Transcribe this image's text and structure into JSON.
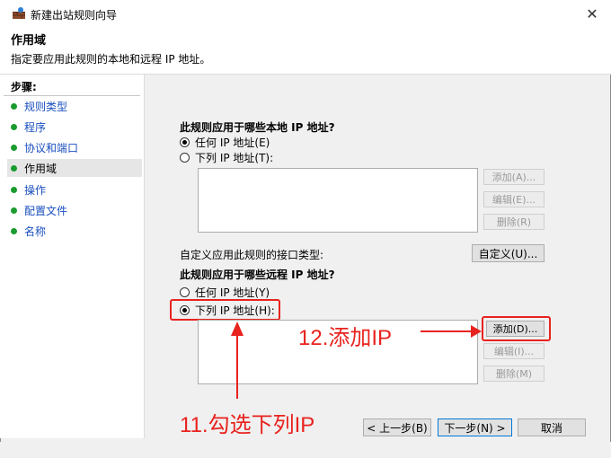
{
  "window": {
    "title": "新建出站规则向导",
    "close_glyph": "✕",
    "icon": "firewall-icon"
  },
  "header": {
    "title": "作用域",
    "description": "指定要应用此规则的本地和远程 IP 地址。"
  },
  "steps": {
    "heading": "步骤:",
    "items": [
      {
        "label": "规则类型",
        "active": false
      },
      {
        "label": "程序",
        "active": false
      },
      {
        "label": "协议和端口",
        "active": false
      },
      {
        "label": "作用域",
        "active": true
      },
      {
        "label": "操作",
        "active": false
      },
      {
        "label": "配置文件",
        "active": false
      },
      {
        "label": "名称",
        "active": false
      }
    ]
  },
  "local": {
    "question": "此规则应用于哪些本地 IP 地址?",
    "option_any": "任何 IP 地址(E)",
    "option_list": "下列 IP 地址(T):",
    "selected": "any",
    "add": "添加(A)...",
    "edit": "编辑(E)...",
    "remove": "删除(R)"
  },
  "interface": {
    "label": "自定义应用此规则的接口类型:",
    "button": "自定义(U)..."
  },
  "remote": {
    "question": "此规则应用于哪些远程 IP 地址?",
    "option_any": "任何 IP 地址(Y)",
    "option_list": "下列 IP 地址(H):",
    "selected": "list",
    "add": "添加(D)...",
    "edit": "编辑(I)...",
    "remove": "删除(M)"
  },
  "annotations": {
    "step12": "12.添加IP",
    "step11": "11.勾选下列IP",
    "color": "#e8231f"
  },
  "footer": {
    "back": "< 上一步(B)",
    "next": "下一步(N) >",
    "cancel": "取消"
  }
}
